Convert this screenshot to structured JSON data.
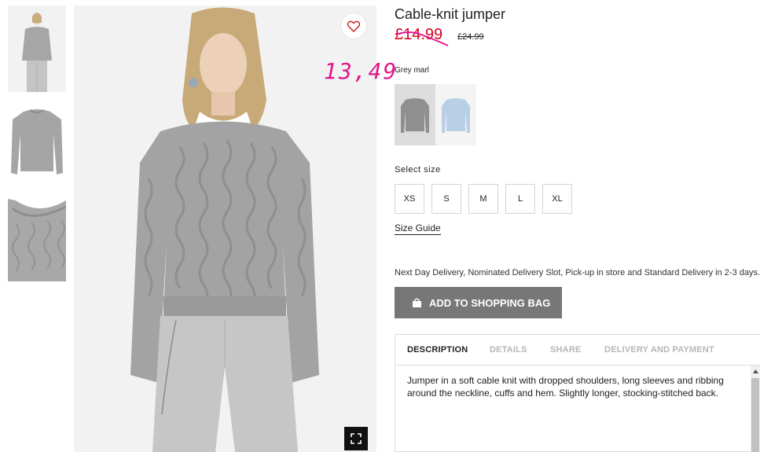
{
  "product": {
    "title": "Cable-knit jumper",
    "price_sale": "£14.99",
    "price_original": "£24.99",
    "annotation": "13,49",
    "color_name": "Grey marl"
  },
  "swatches": [
    {
      "name": "grey-marl",
      "color": "#8f8f8f",
      "selected": true
    },
    {
      "name": "light-blue",
      "color": "#b9cfe6",
      "selected": false
    }
  ],
  "sizes": {
    "label": "Select size",
    "options": [
      "XS",
      "S",
      "M",
      "L",
      "XL"
    ],
    "guide_label": "Size Guide"
  },
  "delivery": {
    "text": "Next Day Delivery, Nominated Delivery Slot, Pick-up in store and Standard Delivery in 2-3 days."
  },
  "cart": {
    "add_label": "ADD TO SHOPPING BAG"
  },
  "tabs": {
    "items": [
      "DESCRIPTION",
      "DETAILS",
      "SHARE",
      "DELIVERY AND PAYMENT"
    ],
    "active": "DESCRIPTION",
    "description": "Jumper in a soft cable knit with dropped shoulders, long sleeves and ribbing around the neckline, cuffs and hem. Slightly longer, stocking-stitched back."
  },
  "icons": {
    "favourite": "heart-icon",
    "expand": "expand-icon",
    "bag": "shopping-bag-icon"
  },
  "colors": {
    "sale": "#d6001c",
    "annotation": "#e0188c",
    "button": "#777777"
  }
}
